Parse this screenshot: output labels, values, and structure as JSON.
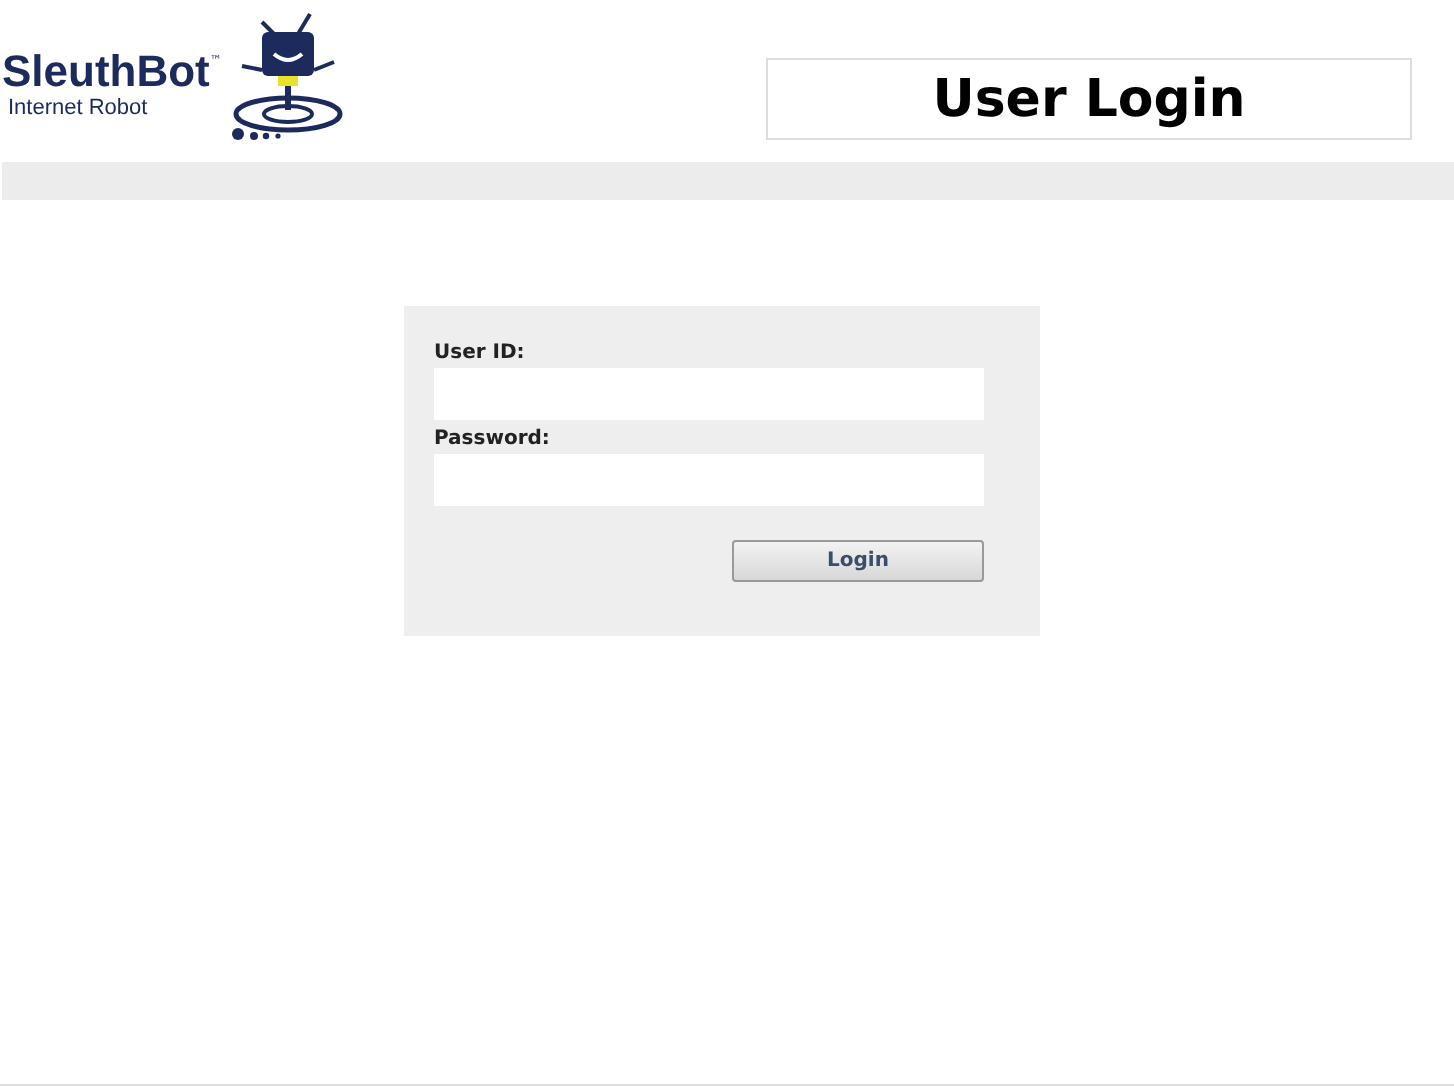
{
  "logo": {
    "name": "SleuthBot",
    "trademark": "™",
    "tagline": "Internet Robot"
  },
  "header": {
    "title": "User Login"
  },
  "form": {
    "fields": [
      {
        "label": "User ID:"
      },
      {
        "label": "Password:"
      }
    ],
    "button": "Login"
  }
}
